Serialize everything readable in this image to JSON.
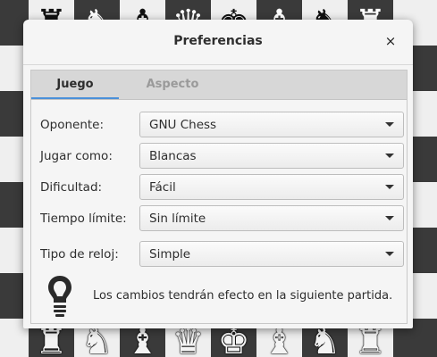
{
  "dialog": {
    "title": "Preferencias",
    "close_glyph": "×",
    "tabs": [
      {
        "label": "Juego",
        "active": true
      },
      {
        "label": "Aspecto",
        "active": false
      }
    ],
    "settings": [
      {
        "label": "Oponente:",
        "value": "GNU Chess"
      },
      {
        "label": "Jugar como:",
        "value": "Blancas"
      },
      {
        "label": "Dificultad:",
        "value": "Fácil"
      },
      {
        "label": "Tiempo límite:",
        "value": "Sin límite"
      },
      {
        "label": "Tipo de reloj:",
        "value": "Simple"
      }
    ],
    "hint": {
      "icon": "lightbulb-icon",
      "text": "Los cambios tendrán efecto en la siguiente partida."
    },
    "accent_color": "#4a90d9"
  },
  "board": {
    "top_row": [
      "",
      "♜",
      "",
      "♞",
      "",
      "♝",
      "",
      "♛",
      "",
      "♚",
      "",
      "♝",
      "",
      "♞",
      "",
      "♜"
    ],
    "bottom_row": [
      "♜",
      "♞",
      "♗",
      "♕",
      "♔",
      "♗",
      "♞",
      "♜"
    ]
  }
}
